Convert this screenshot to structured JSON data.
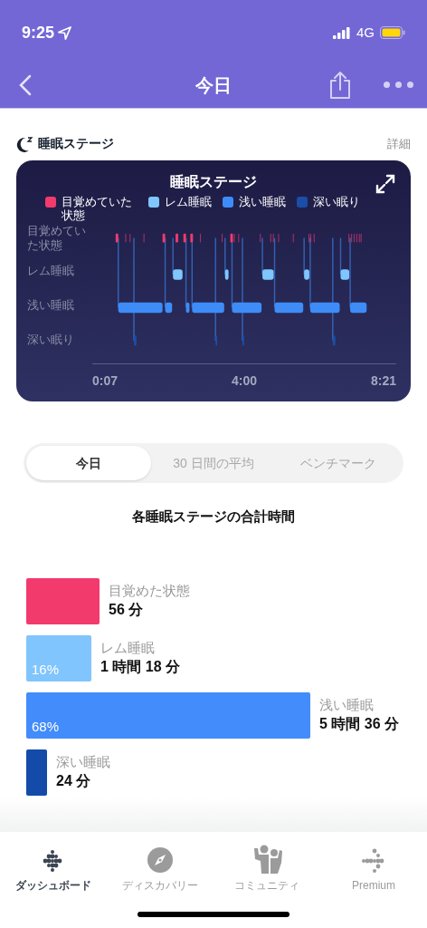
{
  "status_bar": {
    "time": "9:25",
    "network": "4G"
  },
  "nav": {
    "title": "今日"
  },
  "section": {
    "title": "睡眠ステージ",
    "link": "詳細"
  },
  "chart_card": {
    "title": "睡眠ステージ",
    "legend": [
      {
        "label": "目覚めていた状態",
        "color": "#f23a6c"
      },
      {
        "label": "レム睡眠",
        "color": "#7fc6fd"
      },
      {
        "label": "浅い睡眠",
        "color": "#3d8cf7"
      },
      {
        "label": "深い眠り",
        "color": "#1a4ea8"
      }
    ],
    "y_labels": [
      "目覚めていた状態",
      "レム睡眠",
      "浅い睡眠",
      "深い眠り"
    ],
    "x_labels": [
      "0:07",
      "4:00",
      "8:21"
    ]
  },
  "tabs": [
    {
      "label": "今日",
      "selected": true
    },
    {
      "label": "30 日間の平均",
      "selected": false
    },
    {
      "label": "ベンチマーク",
      "selected": false
    }
  ],
  "summary": {
    "title": "各睡眠ステージの合計時間",
    "bars": [
      {
        "label": "目覚めた状態",
        "duration": "56 分",
        "color": "#f23a6c"
      },
      {
        "label": "レム睡眠",
        "duration": "1 時間 18 分",
        "percent": "16%",
        "color": "#80c5fd"
      },
      {
        "label": "浅い睡眠",
        "duration": "5 時間 36 分",
        "percent": "68%",
        "color": "#428cfb"
      },
      {
        "label": "深い睡眠",
        "duration": "24 分",
        "color": "#154ba8"
      }
    ]
  },
  "bottom_nav": [
    {
      "label": "ダッシュボード",
      "selected": true
    },
    {
      "label": "ディスカバリー",
      "selected": false
    },
    {
      "label": "コミュニティ",
      "selected": false
    },
    {
      "label": "Premium",
      "selected": false
    }
  ]
}
